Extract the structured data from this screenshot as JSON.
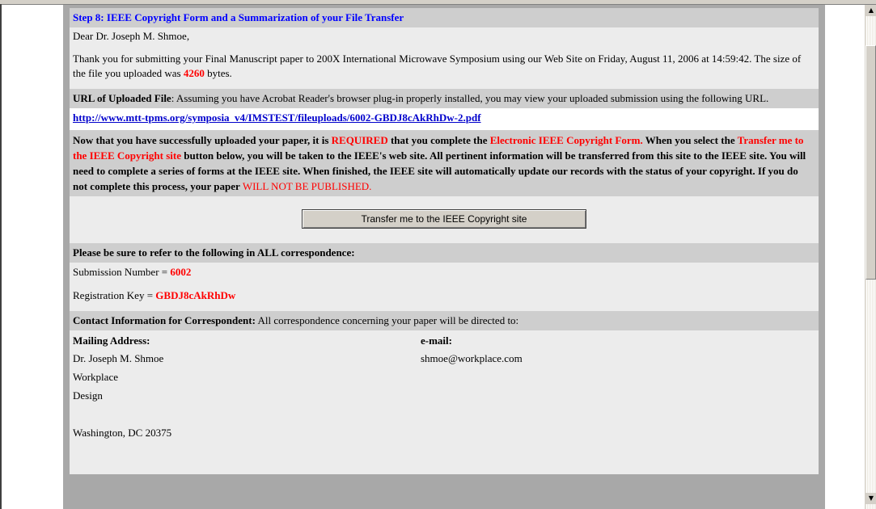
{
  "step_title": "Step 8: IEEE Copyright Form and a Summarization of your File Transfer",
  "greeting": "Dear Dr. Joseph M. Shmoe,",
  "thanks": {
    "text_before": "Thank you for submitting your Final Manuscript paper to 200X International Microwave Symposium using our Web Site on Friday, August 11, 2006 at 14:59:42. The size of the file you uploaded was ",
    "size": "4260",
    "text_after": " bytes."
  },
  "url_section": {
    "label": "URL of Uploaded File",
    "text": ": Assuming you have Acrobat Reader's browser plug-in properly installed, you may view your uploaded submission using the following URL.",
    "link": "http://www.mtt-tpms.org/symposia_v4/IMSTEST/fileuploads/6002-GBDJ8cAkRhDw-2.pdf"
  },
  "notice": {
    "p1": "Now that you have successfully uploaded your paper, it is ",
    "required": "REQUIRED",
    "p2": " that you complete the ",
    "form_name": "Electronic IEEE Copyright Form.",
    "p3": " When you select the ",
    "button_ref": "Transfer me to the IEEE Copyright site",
    "p4": " button below, you will be taken to the IEEE's web site. All pertinent information will be transferred from this site to the IEEE site. You will need to complete a series of forms at the IEEE site. When finished, the IEEE site will automatically update our records with the status of your copyright. If you do not complete this process, your paper ",
    "not_published": "WILL NOT BE PUBLISHED",
    "p5": "."
  },
  "transfer_button": "Transfer me to the IEEE Copyright site",
  "refer_heading": "Please be sure to refer to the following in ALL correspondence:",
  "submission": {
    "label": "Submission Number = ",
    "value": "6002"
  },
  "registration": {
    "label": "Registration Key = ",
    "value": "GBDJ8cAkRhDw"
  },
  "contact": {
    "label": "Contact Information for Correspondent:",
    "text": " All correspondence concerning your paper will be directed to:",
    "mailing_heading": "Mailing Address:",
    "email_heading": "e-mail:",
    "address_lines": [
      "Dr. Joseph M. Shmoe",
      "Workplace",
      "Design",
      "",
      "Washington, DC 20375"
    ],
    "email": "shmoe@workplace.com"
  },
  "scrollbar": {
    "up_arrow": "▲",
    "down_arrow": "▼"
  }
}
